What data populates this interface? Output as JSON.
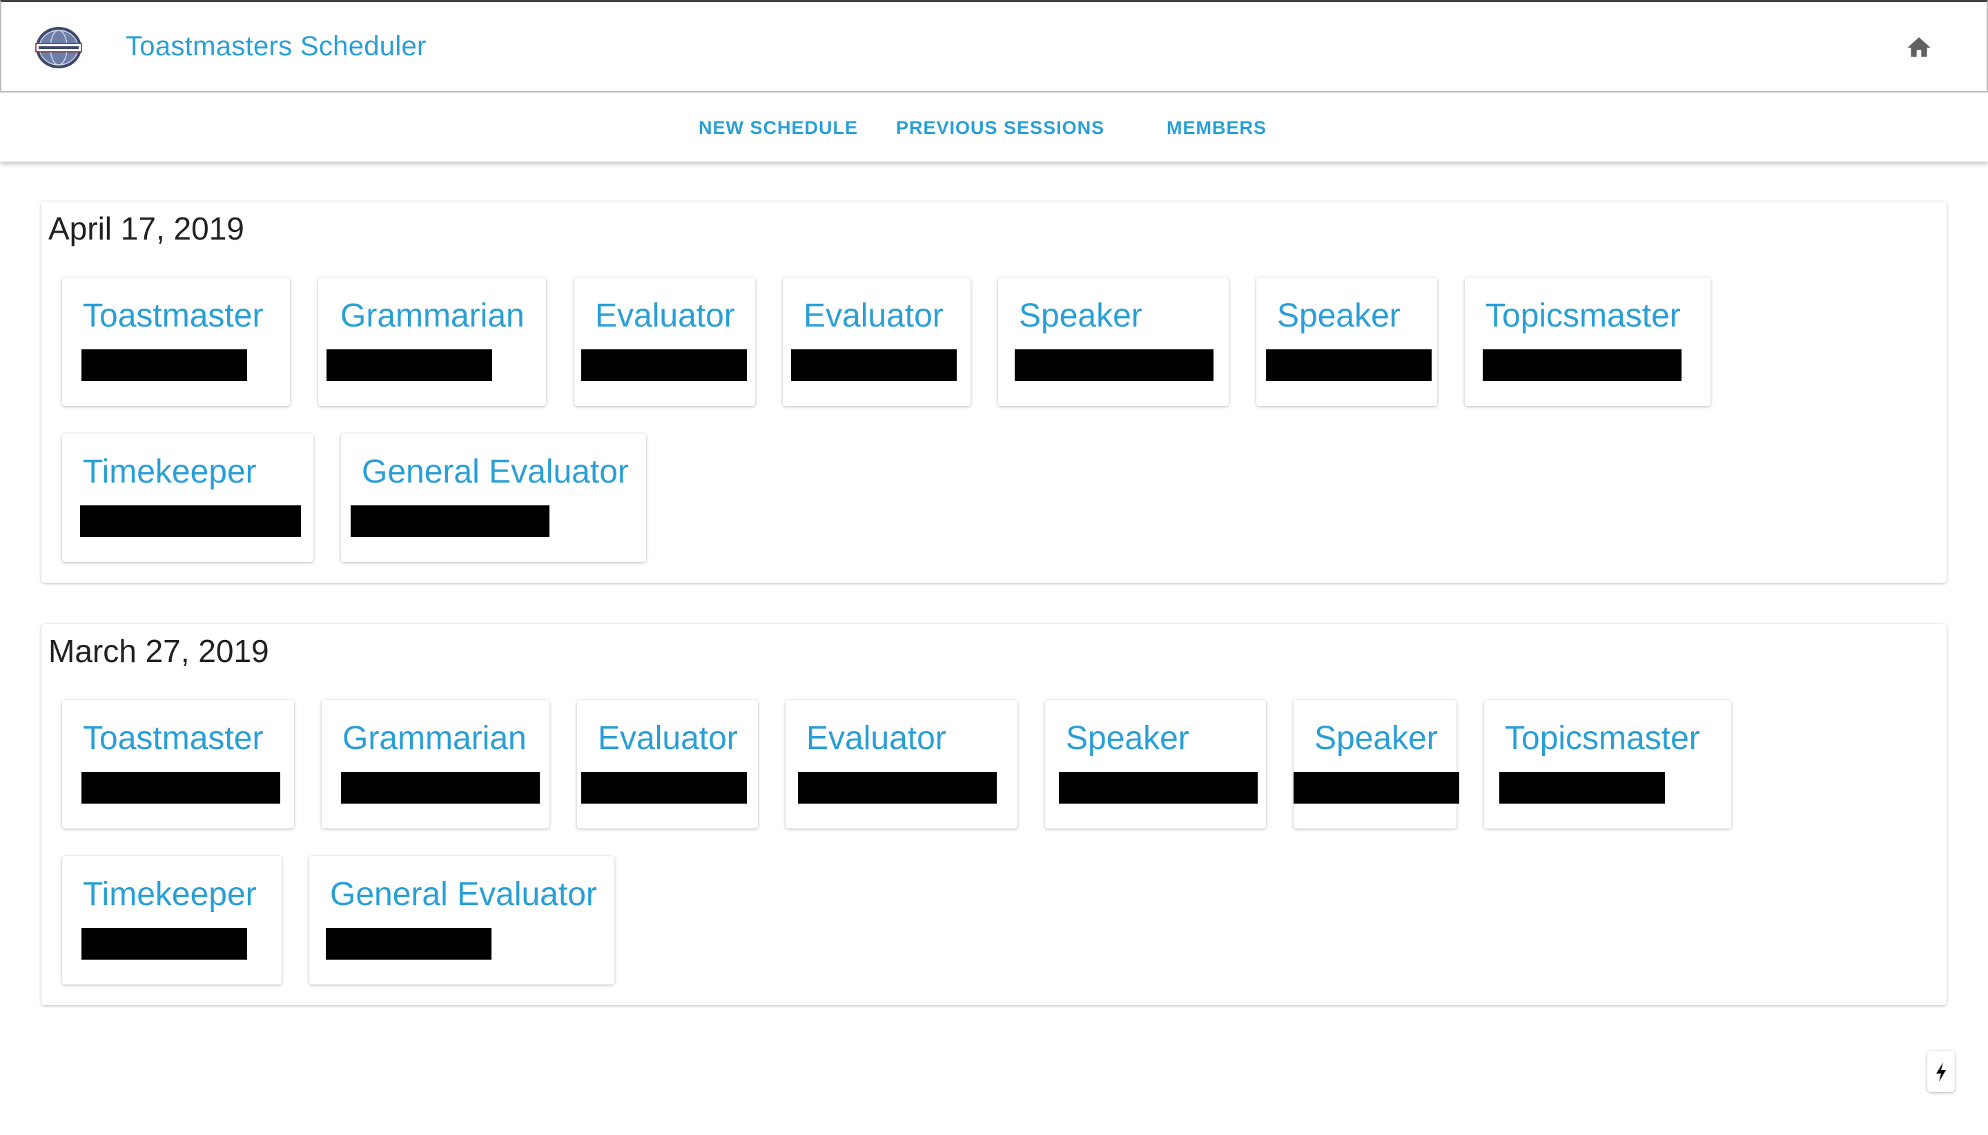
{
  "app": {
    "title": "Toastmasters Scheduler",
    "logo_icon": "toastmasters-globe-logo",
    "home_icon": "home-icon",
    "accent_color": "#2a9fd6"
  },
  "nav": {
    "tabs": [
      {
        "label": "NEW SCHEDULE"
      },
      {
        "label": "PREVIOUS SESSIONS"
      },
      {
        "label": "MEMBERS"
      }
    ]
  },
  "sessions": [
    {
      "date": "April 17, 2019",
      "roles": [
        {
          "role": "Toastmaster",
          "name": "[redacted]"
        },
        {
          "role": "Grammarian",
          "name": "[redacted]"
        },
        {
          "role": "Evaluator",
          "name": "[redacted]"
        },
        {
          "role": "Evaluator",
          "name": "[redacted]"
        },
        {
          "role": "Speaker",
          "name": "[redacted]"
        },
        {
          "role": "Speaker",
          "name": "[redacted]"
        },
        {
          "role": "Topicsmaster",
          "name": "[redacted]"
        },
        {
          "role": "Timekeeper",
          "name": "[redacted]"
        },
        {
          "role": "General Evaluator",
          "name": "[redacted]"
        }
      ]
    },
    {
      "date": "March 27, 2019",
      "roles": [
        {
          "role": "Toastmaster",
          "name": "[redacted]"
        },
        {
          "role": "Grammarian",
          "name": "[redacted]"
        },
        {
          "role": "Evaluator",
          "name": "[redacted]"
        },
        {
          "role": "Evaluator",
          "name": "[redacted]"
        },
        {
          "role": "Speaker",
          "name": "[redacted]"
        },
        {
          "role": "Speaker",
          "name": "[redacted]"
        },
        {
          "role": "Topicsmaster",
          "name": "[redacted]"
        },
        {
          "role": "Timekeeper",
          "name": "[redacted]"
        },
        {
          "role": "General Evaluator",
          "name": "[redacted]"
        }
      ]
    }
  ],
  "fab": {
    "icon": "lightning-bolt-icon"
  }
}
